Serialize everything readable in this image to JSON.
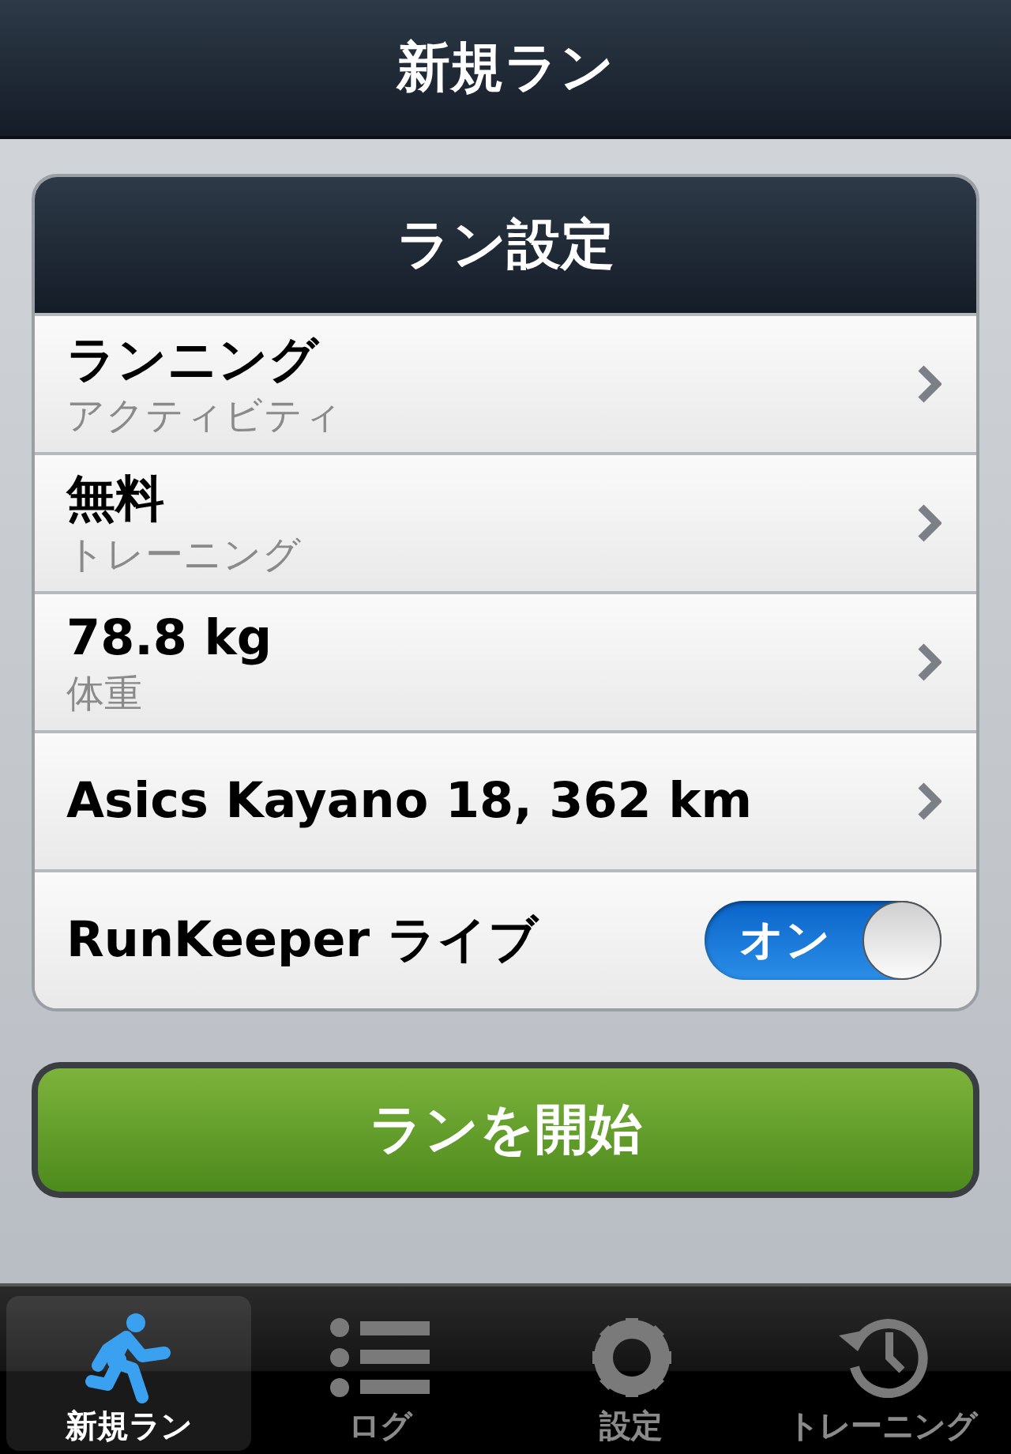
{
  "nav_bar": {
    "title": "新規ラン"
  },
  "settings": {
    "header": "ラン設定",
    "rows": [
      {
        "kind": "detail",
        "title": "ランニング",
        "subtitle": "アクティビティ"
      },
      {
        "kind": "detail",
        "title": "無料",
        "subtitle": "トレーニング"
      },
      {
        "kind": "detail",
        "title": "78.8 kg",
        "subtitle": "体重"
      },
      {
        "kind": "single",
        "title": "Asics Kayano 18, 362 km"
      },
      {
        "kind": "toggle",
        "title": "RunKeeper ライブ",
        "on": true,
        "toggle_label": "オン"
      }
    ]
  },
  "start_button": {
    "label": "ランを開始"
  },
  "tab_bar": [
    {
      "kind": "runner",
      "label": "新規ラン",
      "selected": true
    },
    {
      "kind": "list",
      "label": "ログ",
      "selected": false
    },
    {
      "kind": "gear",
      "label": "設定",
      "selected": false
    },
    {
      "kind": "history",
      "label": "トレーニング",
      "selected": false
    }
  ]
}
